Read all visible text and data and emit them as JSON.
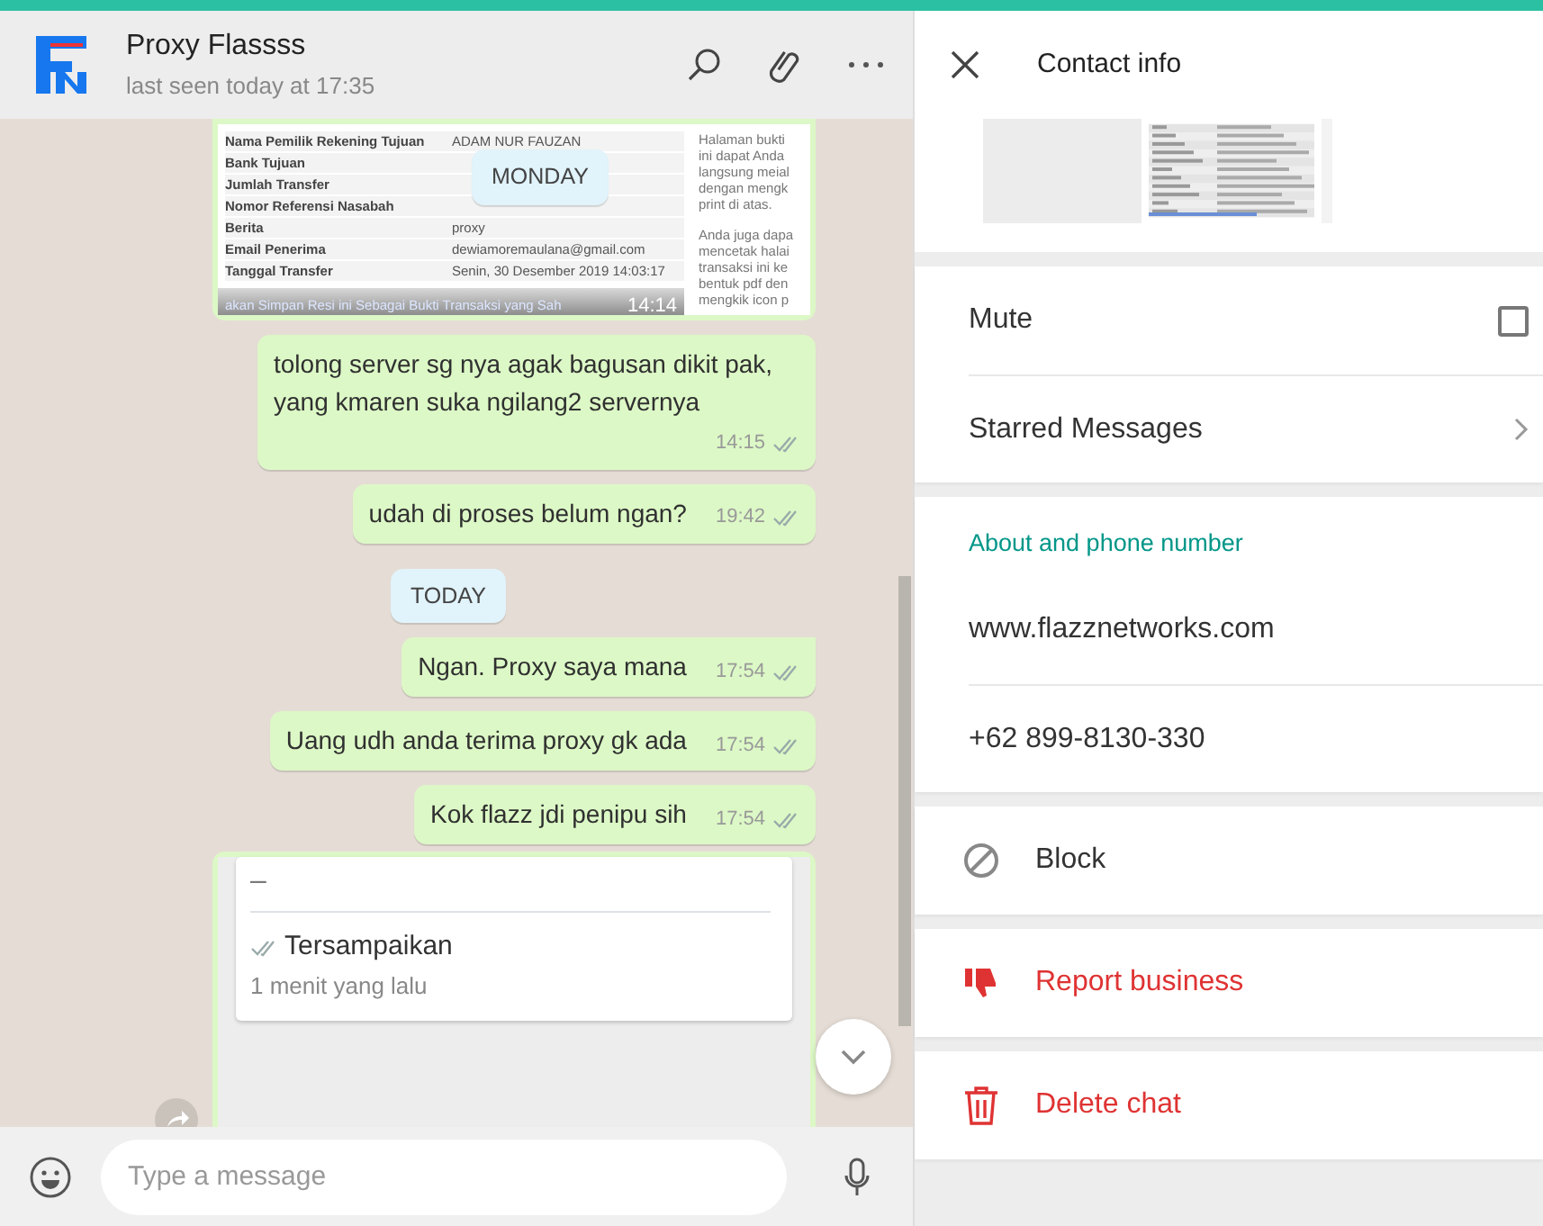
{
  "header": {
    "title": "Proxy Flassss",
    "subtitle": "last seen today at 17:35"
  },
  "sticky_date": "MONDAY",
  "messages": [
    {
      "kind": "receipt",
      "rows": [
        {
          "label": "Nama Pemilik Rekening Tujuan",
          "value": "ADAM NUR FAUZAN"
        },
        {
          "label": "Bank Tujuan"
        },
        {
          "label": "Jumlah Transfer"
        },
        {
          "label": "Nomor Referensi Nasabah"
        },
        {
          "label": "Berita",
          "value": "proxy"
        },
        {
          "label": "Email Penerima",
          "value": "dewiamoremaulana@gmail.com"
        },
        {
          "label": "Tanggal Transfer",
          "value": "Senin, 30 Desember 2019 14:03:17"
        }
      ],
      "side_text": [
        "Halaman bukti",
        "ini dapat Anda",
        "langsung meial",
        "dengan mengk",
        "print di atas.",
        "Anda juga dapa",
        "mencetak halai",
        "transaksi ini ke",
        "bentuk pdf den",
        "mengkik icon p"
      ],
      "caption": "akan Simpan Resi ini Sebagai Bukti Transaksi yang Sah",
      "time": "14:14"
    },
    {
      "kind": "text",
      "text": "tolong server sg nya agak bagusan dikit pak, yang kmaren suka ngilang2 servernya",
      "time": "14:15"
    },
    {
      "kind": "text",
      "text": "udah di proses belum ngan?",
      "time": "19:42"
    },
    {
      "kind": "date",
      "text": "TODAY"
    },
    {
      "kind": "text",
      "text": "Ngan. Proxy saya mana",
      "time": "17:54",
      "tail": true
    },
    {
      "kind": "text",
      "text": "Uang udh anda terima proxy gk ada",
      "time": "17:54"
    },
    {
      "kind": "text",
      "text": "Kok flazz jdi penipu sih",
      "time": "17:54"
    },
    {
      "kind": "status_card",
      "dash": "–",
      "status": "Tersampaikan",
      "when": "1 menit yang lalu"
    }
  ],
  "composer": {
    "placeholder": "Type a message"
  },
  "contact": {
    "title": "Contact info",
    "settings": [
      {
        "kind": "toggle",
        "label": "Mute",
        "checked": false
      },
      {
        "kind": "link",
        "label": "Starred Messages"
      }
    ],
    "about": {
      "heading": "About and phone number",
      "lines": [
        "www.flazznetworks.com",
        "+62 899-8130-330"
      ]
    },
    "actions": [
      {
        "kind": "block",
        "label": "Block",
        "danger": false
      },
      {
        "kind": "report",
        "label": "Report business",
        "danger": true
      },
      {
        "kind": "delete",
        "label": "Delete chat",
        "danger": true
      }
    ]
  }
}
